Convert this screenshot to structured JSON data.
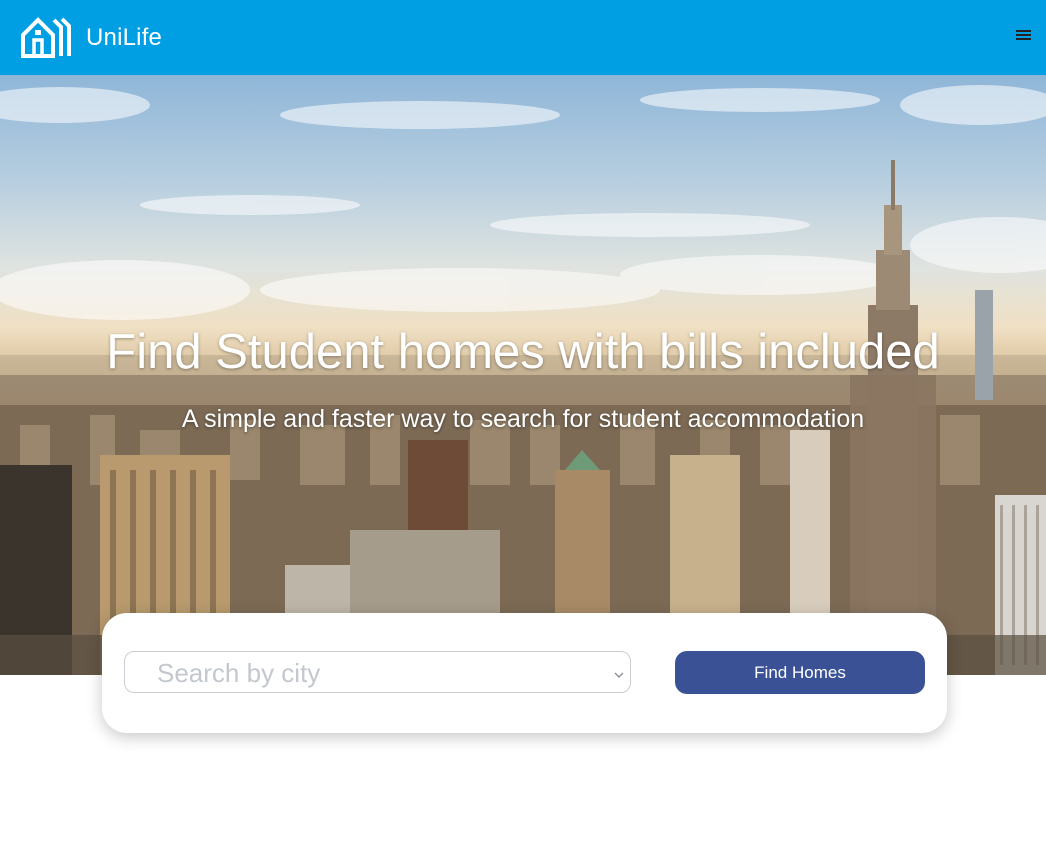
{
  "navbar": {
    "brand": "UniLife",
    "background": "#009fe3",
    "logo_icon": "house-logo-icon",
    "menu_icon": "hamburger-menu-icon"
  },
  "hero": {
    "title": "Find Student homes with bills included",
    "subtitle": "A simple and faster way to search for student accommodation",
    "background_image": "city-skyline-photo"
  },
  "search": {
    "city_placeholder": "Search by city",
    "find_button_label": "Find Homes",
    "button_color": "#3a5295"
  }
}
